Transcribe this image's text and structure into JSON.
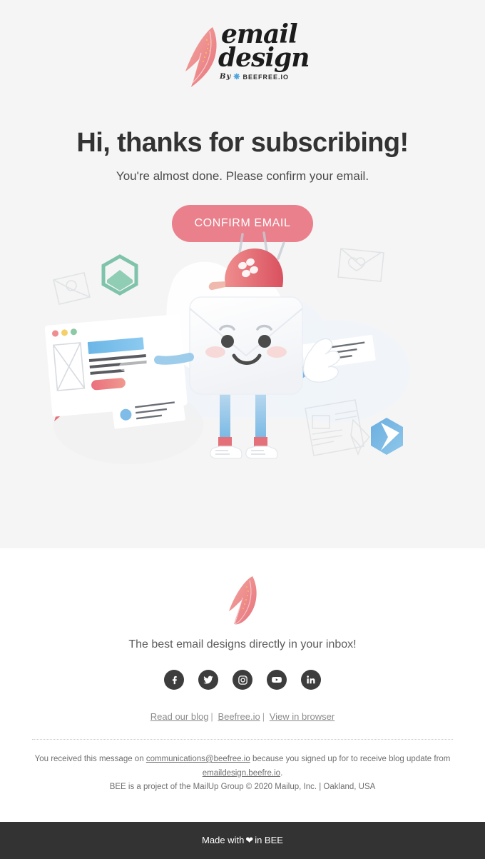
{
  "theme": {
    "hero_bg": "#f5f5f5",
    "footer_bg": "#ffffff",
    "bottom_bar_bg": "#333333",
    "accent_pink": "#ea808c",
    "heading_color": "#333333",
    "muted_text": "#6f6f6f",
    "social_circle": "#3d3d3d"
  },
  "header": {
    "logo": {
      "icon": "feather-icon",
      "line1": "email",
      "line2": "design",
      "byline_prefix": "By",
      "byline_mark": "bee-icon",
      "byline_brand": "BEEFREE.IO"
    }
  },
  "hero": {
    "headline": "Hi, thanks for subscribing!",
    "subheadline": "You're almost done. Please confirm your email.",
    "cta_label": "CONFIRM EMAIL",
    "illustration": {
      "name": "smiling-envelope-character-illustration",
      "elements": [
        "envelope-character",
        "red-cap",
        "waving-hand",
        "browser-window-mockup",
        "green-hexagon",
        "blue-hexagon",
        "red-feather",
        "message-card-blue-dot",
        "message-card-green-dot",
        "envelope-outline",
        "heart-envelope-outline",
        "newspaper-pencil-outline",
        "cloud-shapes"
      ]
    }
  },
  "footer": {
    "feather_icon": "feather-icon",
    "tagline": "The best email designs directly in your inbox!",
    "social": [
      {
        "name": "facebook",
        "label": "Facebook"
      },
      {
        "name": "twitter",
        "label": "Twitter"
      },
      {
        "name": "instagram",
        "label": "Instagram"
      },
      {
        "name": "youtube",
        "label": "YouTube"
      },
      {
        "name": "linkedin",
        "label": "LinkedIn"
      }
    ],
    "links": [
      {
        "label": "Read our blog"
      },
      {
        "label": "Beefree.io"
      },
      {
        "label": "View in browser"
      }
    ],
    "link_separator": "|",
    "legal": {
      "line1_part1": "You received this message on",
      "line1_email": "communications@beefree.io",
      "line1_part2": "because you signed up for  to receive blog update from",
      "line1_site": "emaildesign.beefre.io",
      "line1_part3": ".",
      "line2": "BEE is a project of the MailUp Group © 2020 Mailup, Inc. | Oakland, USA"
    }
  },
  "bottom_bar": {
    "prefix": "Made with",
    "heart": "❤",
    "suffix": "in BEE"
  }
}
